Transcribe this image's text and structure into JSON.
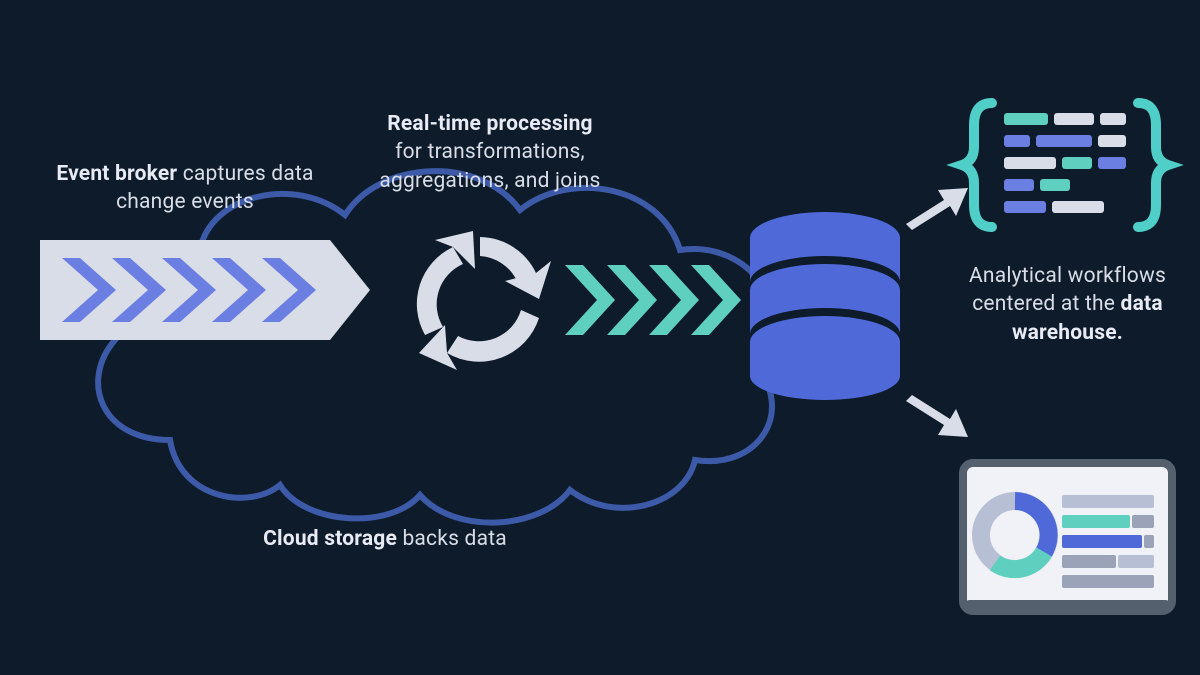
{
  "labels": {
    "event_broker_bold": "Event broker",
    "event_broker_rest": " captures data change events",
    "realtime_bold": "Real-time processing",
    "realtime_rest": "for transformations, aggregations, and joins",
    "cloud_bold": "Cloud storage",
    "cloud_rest": " backs data",
    "analytics_pre": "Analytical workflows centered at the ",
    "analytics_bold": "data warehouse."
  },
  "colors": {
    "bg": "#0d1b2a",
    "cloud_stroke": "#3d5aa8",
    "arrow_fill": "#d9dde8",
    "chevron_blue": "#6b7fe3",
    "chevron_teal": "#5fd0c0",
    "db_blue": "#4f69d8",
    "db_dark": "#0d1b2a",
    "brace_teal": "#4fcfc8",
    "code_teal": "#5fd0c0",
    "code_blue": "#6b7fe3",
    "code_gray": "#d9dde8",
    "panel_border": "#55606e",
    "panel_fill": "#f0f2f7",
    "donut_blue": "#4f69d8",
    "donut_teal": "#5fd0c0",
    "donut_gray": "#b7bfd4",
    "bar_gray": "#9aa3b8"
  }
}
